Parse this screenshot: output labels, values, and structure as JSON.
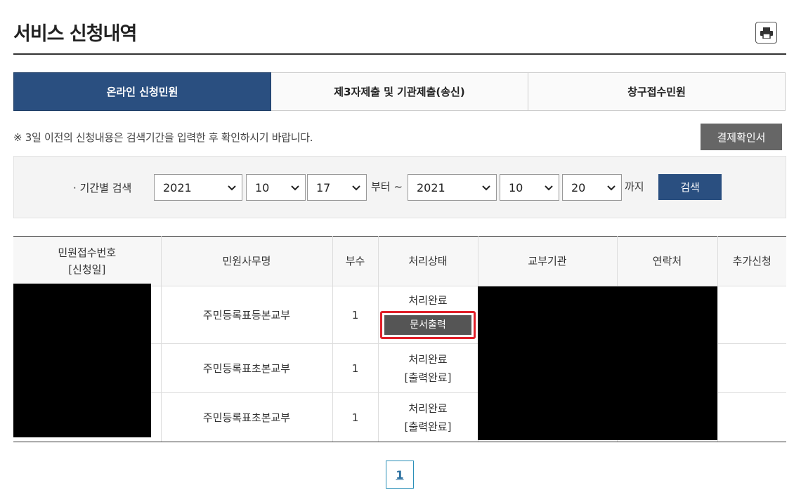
{
  "header": {
    "title": "서비스 신청내역",
    "print_icon": "printer-icon"
  },
  "tabs": [
    {
      "label": "온라인 신청민원",
      "active": true
    },
    {
      "label": "제3자제출 및 기관제출(송신)",
      "active": false
    },
    {
      "label": "창구접수민원",
      "active": false
    }
  ],
  "notice": "※ 3일 이전의 신청내용은 검색기간을 입력한 후 확인하시기 바랍니다.",
  "pay_button": "결제확인서",
  "search": {
    "label": "· 기간별 검색",
    "from": {
      "year": "2021",
      "month": "10",
      "day": "17"
    },
    "from_suffix": "부터 ~",
    "to": {
      "year": "2021",
      "month": "10",
      "day": "20"
    },
    "to_suffix": "까지",
    "button": "검색"
  },
  "table": {
    "headers": [
      "민원접수번호",
      "[신청일]",
      "민원사무명",
      "부수",
      "처리상태",
      "교부기관",
      "연락처",
      "추가신청"
    ],
    "rows": [
      {
        "name": "주민등록표등본교부",
        "copies": "1",
        "status": "처리완료",
        "action": "문서출력"
      },
      {
        "name": "주민등록표초본교부",
        "copies": "1",
        "status": "처리완료",
        "note": "[출력완료]"
      },
      {
        "name": "주민등록표초본교부",
        "copies": "1",
        "status": "처리완료",
        "note": "[출력완료]"
      }
    ]
  },
  "pagination": {
    "current": "1"
  },
  "colors": {
    "accent": "#2a4f80",
    "highlight": "#e0202a"
  }
}
